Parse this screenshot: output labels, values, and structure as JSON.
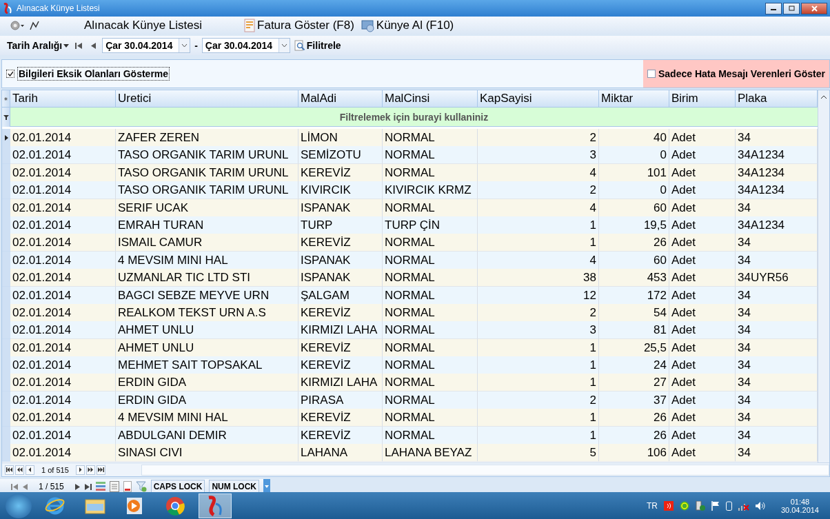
{
  "window": {
    "title": "Alınacak Künye Listesi"
  },
  "toolbar": {
    "title": "Alınacak Künye Listesi",
    "buttons": [
      {
        "label": "Fatura Göster (F8)",
        "kind": "invoice"
      },
      {
        "label": "Künye Al (F10)",
        "kind": "fetch"
      }
    ]
  },
  "filter_bar": {
    "range_label": "Tarih Aralığı",
    "start_date": "Çar 30.04.2014",
    "separator": "-",
    "end_date": "Çar 30.04.2014",
    "filter_button": "Filitrele"
  },
  "options": [
    {
      "label": "Bilgileri Eksik Olanları Gösterme",
      "checked": true,
      "kind": "plain"
    },
    {
      "label": "Sadece Hata Mesajı Verenleri Göster",
      "checked": false,
      "kind": "warning"
    }
  ],
  "table": {
    "columns": [
      "Tarih",
      "Uretici",
      "MalAdi",
      "MalCinsi",
      "KapSayisi",
      "Miktar",
      "Birim",
      "Plaka"
    ],
    "filter_hint": "Filtrelemek için burayi kullaniniz",
    "rows": [
      {
        "selected": true,
        "cells": [
          "02.01.2014",
          "ZAFER ZEREN",
          "LİMON",
          "NORMAL",
          "2",
          "40",
          "Adet",
          "34"
        ]
      },
      {
        "selected": false,
        "cells": [
          "02.01.2014",
          "TASO ORGANIK TARIM URUNL",
          "SEMİZOTU",
          "NORMAL",
          "3",
          "0",
          "Adet",
          "34A1234"
        ]
      },
      {
        "selected": false,
        "cells": [
          "02.01.2014",
          "TASO ORGANIK TARIM URUNL",
          "KEREVİZ",
          "NORMAL",
          "4",
          "101",
          "Adet",
          "34A1234"
        ]
      },
      {
        "selected": false,
        "cells": [
          "02.01.2014",
          "TASO ORGANIK TARIM URUNL",
          "KIVIRCIK",
          "KIVIRCIK KRMZ",
          "2",
          "0",
          "Adet",
          "34A1234"
        ]
      },
      {
        "selected": false,
        "cells": [
          "02.01.2014",
          "SERIF UCAK",
          "ISPANAK",
          "NORMAL",
          "4",
          "60",
          "Adet",
          "34"
        ]
      },
      {
        "selected": false,
        "cells": [
          "02.01.2014",
          "EMRAH TURAN",
          "TURP",
          "TURP ÇİN",
          "1",
          "19,5",
          "Adet",
          "34A1234"
        ]
      },
      {
        "selected": false,
        "cells": [
          "02.01.2014",
          "ISMAIL CAMUR",
          "KEREVİZ",
          "NORMAL",
          "1",
          "26",
          "Adet",
          "34"
        ]
      },
      {
        "selected": false,
        "cells": [
          "02.01.2014",
          "4 MEVSIM MINI HAL",
          "ISPANAK",
          "NORMAL",
          "4",
          "60",
          "Adet",
          "34"
        ]
      },
      {
        "selected": false,
        "cells": [
          "02.01.2014",
          "UZMANLAR TIC LTD STI",
          "ISPANAK",
          "NORMAL",
          "38",
          "453",
          "Adet",
          "34UYR56"
        ]
      },
      {
        "selected": false,
        "cells": [
          "02.01.2014",
          "BAGCI SEBZE MEYVE URN",
          "ŞALGAM",
          "NORMAL",
          "12",
          "172",
          "Adet",
          "34"
        ]
      },
      {
        "selected": false,
        "cells": [
          "02.01.2014",
          "REALKOM TEKST URN A.S",
          "KEREVİZ",
          "NORMAL",
          "2",
          "54",
          "Adet",
          "34"
        ]
      },
      {
        "selected": false,
        "cells": [
          "02.01.2014",
          "AHMET UNLU",
          "KIRMIZI LAHA",
          "NORMAL",
          "3",
          "81",
          "Adet",
          "34"
        ]
      },
      {
        "selected": false,
        "cells": [
          "02.01.2014",
          "AHMET UNLU",
          "KEREVİZ",
          "NORMAL",
          "1",
          "25,5",
          "Adet",
          "34"
        ]
      },
      {
        "selected": false,
        "cells": [
          "02.01.2014",
          "MEHMET SAIT TOPSAKAL",
          "KEREVİZ",
          "NORMAL",
          "1",
          "24",
          "Adet",
          "34"
        ]
      },
      {
        "selected": false,
        "cells": [
          "02.01.2014",
          "ERDIN GIDA",
          "KIRMIZI LAHA",
          "NORMAL",
          "1",
          "27",
          "Adet",
          "34"
        ]
      },
      {
        "selected": false,
        "cells": [
          "02.01.2014",
          "ERDIN GIDA",
          "PIRASA",
          "NORMAL",
          "2",
          "37",
          "Adet",
          "34"
        ]
      },
      {
        "selected": false,
        "cells": [
          "02.01.2014",
          "4 MEVSIM MINI HAL",
          "KEREVİZ",
          "NORMAL",
          "1",
          "26",
          "Adet",
          "34"
        ]
      },
      {
        "selected": false,
        "cells": [
          "02.01.2014",
          "ABDULGANI DEMIR",
          "KEREVİZ",
          "NORMAL",
          "1",
          "26",
          "Adet",
          "34"
        ]
      },
      {
        "selected": false,
        "cells": [
          "02.01.2014",
          "SINASI CIVI",
          "LAHANA",
          "LAHANA BEYAZ",
          "5",
          "106",
          "Adet",
          "34"
        ]
      }
    ],
    "pager": "1 of 515"
  },
  "status_bar": {
    "position": "1 / 515",
    "keys": [
      "CAPS LOCK",
      "NUM LOCK"
    ]
  },
  "taskbar": {
    "language": "TR",
    "time": "01:48",
    "date": "30.04.2014"
  }
}
